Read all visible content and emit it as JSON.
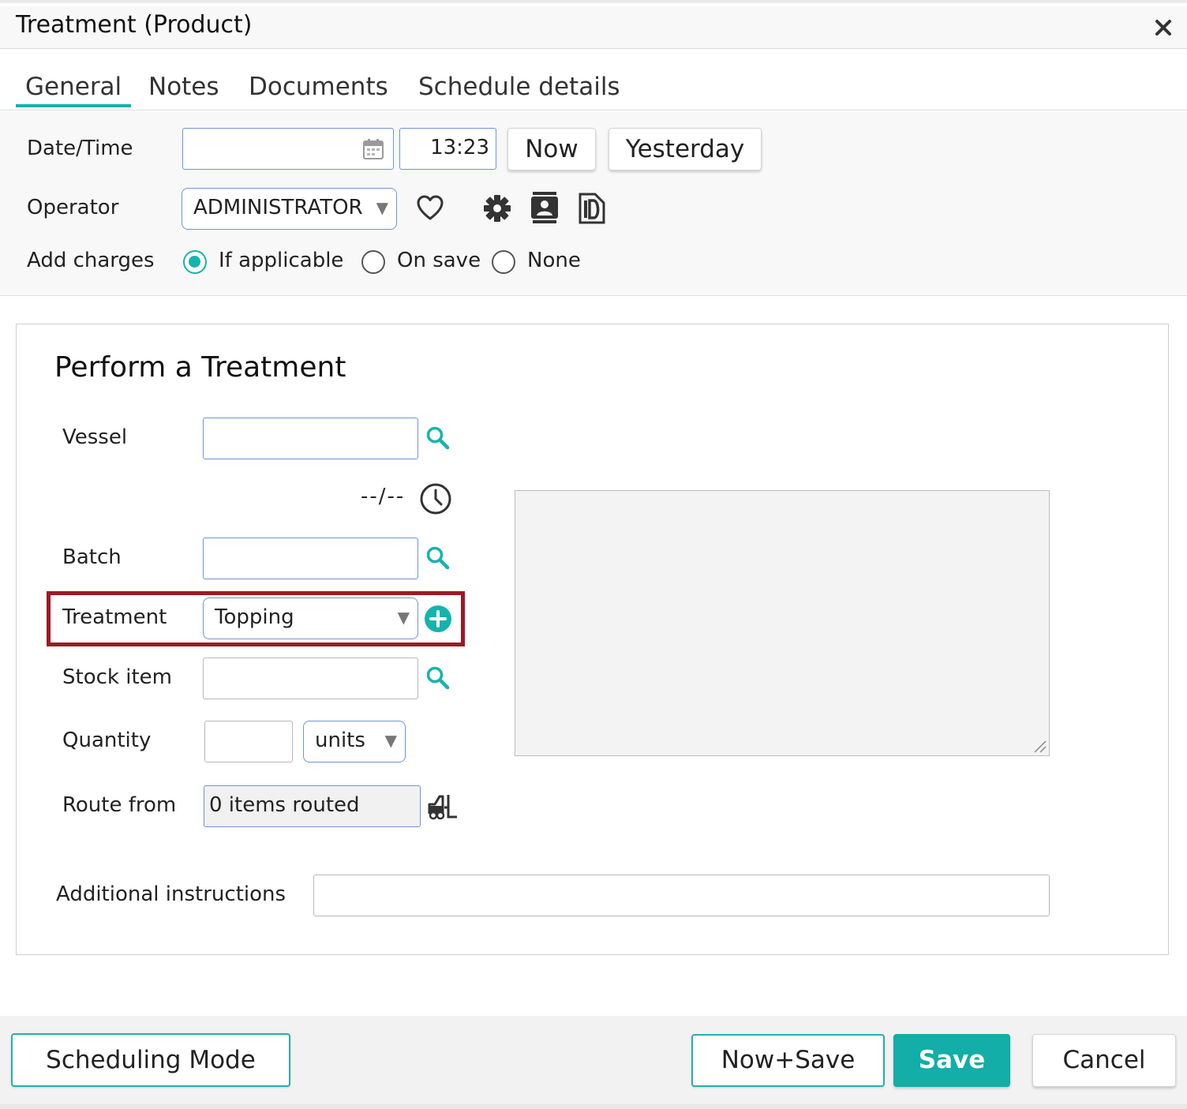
{
  "window": {
    "title": "Treatment (Product)"
  },
  "tabs": [
    {
      "label": "General",
      "active": true
    },
    {
      "label": "Notes"
    },
    {
      "label": "Documents"
    },
    {
      "label": "Schedule details"
    }
  ],
  "header": {
    "datetime_label": "Date/Time",
    "date_value": "",
    "time_value": "13:23",
    "now_label": "Now",
    "yesterday_label": "Yesterday",
    "operator_label": "Operator",
    "operator_value": "ADMINISTRATOR",
    "add_charges_label": "Add charges",
    "charges_options": [
      "If applicable",
      "On save",
      "None"
    ],
    "charges_selected": "If applicable"
  },
  "panel": {
    "title": "Perform a Treatment",
    "vessel_label": "Vessel",
    "vessel_value": "",
    "vessel_date": "--/--",
    "batch_label": "Batch",
    "batch_value": "",
    "treatment_label": "Treatment",
    "treatment_value": "Topping",
    "stock_item_label": "Stock item",
    "stock_item_value": "",
    "quantity_label": "Quantity",
    "quantity_value": "",
    "unit_value": "units",
    "route_from_label": "Route from",
    "route_from_value": "0 items routed",
    "additional_instructions_label": "Additional instructions",
    "additional_instructions_value": ""
  },
  "footer": {
    "scheduling_mode_label": "Scheduling Mode",
    "now_save_label": "Now+Save",
    "save_label": "Save",
    "cancel_label": "Cancel"
  },
  "colors": {
    "accent": "#16b3ad",
    "input_border": "#6f93d6",
    "highlight": "#9b1b25"
  },
  "icons": [
    "close-icon",
    "calendar-icon",
    "heart-icon",
    "gear-icon",
    "contact-card-icon",
    "id-document-icon",
    "search-icon",
    "clock-icon",
    "add-circle-icon",
    "forklift-icon",
    "resize-grip-icon"
  ]
}
